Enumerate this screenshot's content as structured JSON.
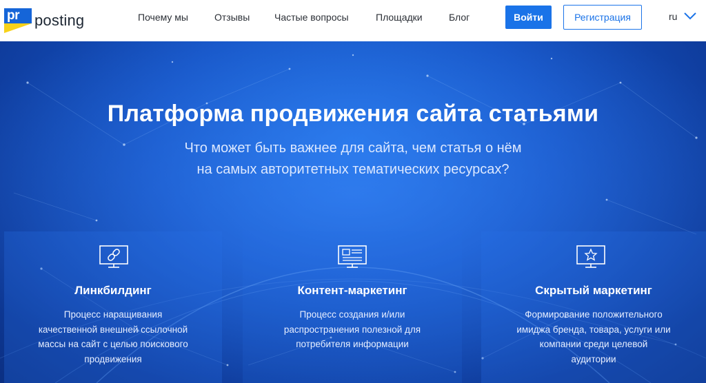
{
  "brand": {
    "mark": "pr",
    "name": "posting"
  },
  "nav": {
    "items": [
      "Почему мы",
      "Отзывы",
      "Частые вопросы",
      "Площадки",
      "Блог"
    ]
  },
  "auth": {
    "login_label": "Войти",
    "register_label": "Регистрация"
  },
  "language": {
    "current": "ru"
  },
  "hero": {
    "title": "Платформа продвижения сайта статьями",
    "subtitle_line1": "Что может быть важнее для сайта, чем статья о нём",
    "subtitle_line2": "на самых авторитетных тематических ресурсах?"
  },
  "features": [
    {
      "icon": "link-monitor-icon",
      "title": "Линкбилдинг",
      "lines": [
        "Процесс наращивания",
        "качественной внешней ссылочной",
        "массы на сайт с целью поискового",
        "продвижения"
      ]
    },
    {
      "icon": "article-monitor-icon",
      "title": "Контент-маркетинг",
      "lines": [
        "Процесс создания и/или",
        "распространения полезной для",
        "потребителя информации"
      ]
    },
    {
      "icon": "star-monitor-icon",
      "title": "Скрытый маркетинг",
      "lines": [
        "Формирование положительного",
        "имиджа бренда, товара, услуги или",
        "компании среди целевой",
        "аудитории"
      ]
    }
  ],
  "colors": {
    "accent": "#1a73e8",
    "hero_bg": "#1553c4",
    "logo_blue": "#1565d8",
    "logo_yellow": "#f7d21a"
  }
}
